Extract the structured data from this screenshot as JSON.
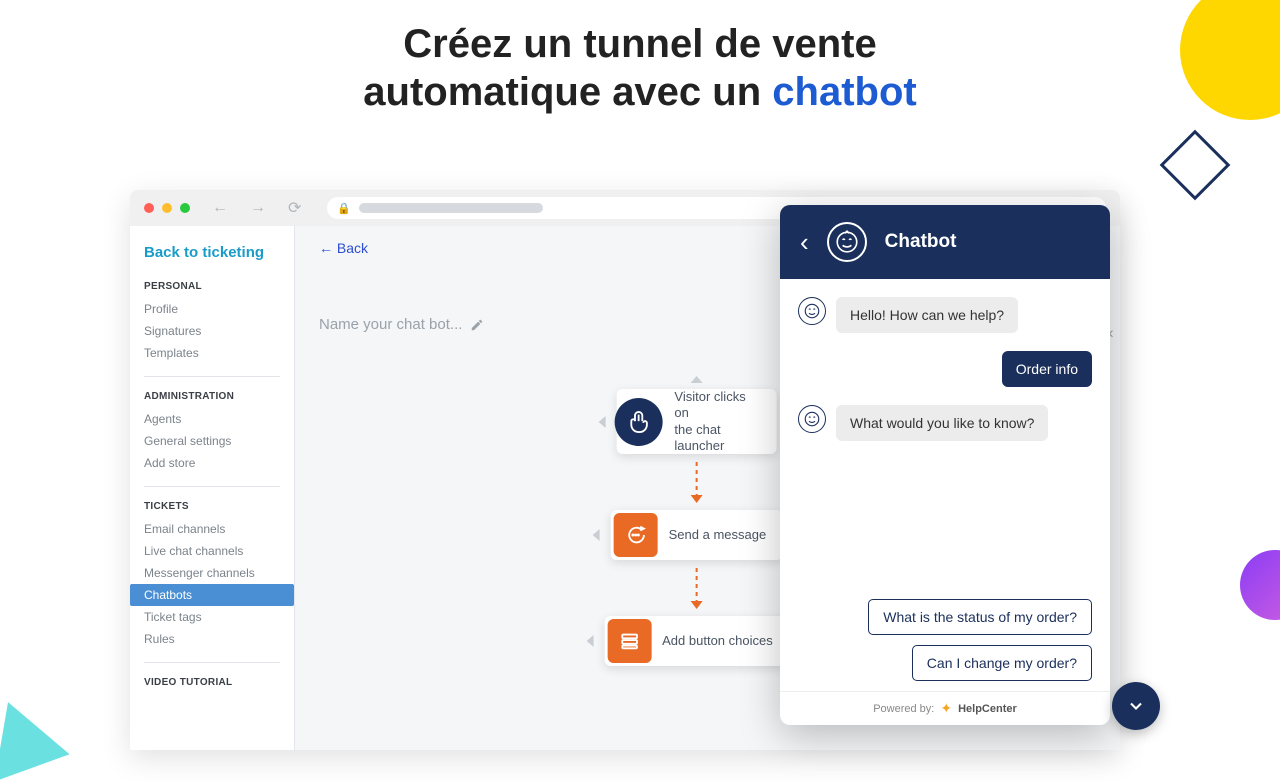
{
  "headline": {
    "line1": "Créez un tunnel de vente",
    "line2_pre": "automatique avec un ",
    "line2_accent": "chatbot"
  },
  "sidebar": {
    "back": "Back to ticketing",
    "sections": [
      {
        "head": "PERSONAL",
        "items": [
          "Profile",
          "Signatures",
          "Templates"
        ]
      },
      {
        "head": "ADMINISTRATION",
        "items": [
          "Agents",
          "General settings",
          "Add store"
        ]
      },
      {
        "head": "TICKETS",
        "items": [
          "Email channels",
          "Live chat channels",
          "Messenger channels",
          "Chatbots",
          "Ticket tags",
          "Rules"
        ]
      },
      {
        "head": "VIDEO TUTORIAL",
        "items": []
      }
    ],
    "active": "Chatbots"
  },
  "main": {
    "back": "Back",
    "name_placeholder": "Name your chat bot...",
    "nodes": [
      {
        "label": "Visitor clicks on the chat launcher",
        "kind": "navy"
      },
      {
        "label": "Send a message",
        "kind": "orange"
      },
      {
        "label": "Add button choices",
        "kind": "orange"
      }
    ]
  },
  "chat": {
    "title": "Chatbot",
    "messages": [
      {
        "role": "bot",
        "text": "Hello! How can we help?"
      },
      {
        "role": "user",
        "text": "Order info"
      },
      {
        "role": "bot",
        "text": "What would you like to know?"
      }
    ],
    "choices": [
      "What is the status of my order?",
      "Can I change my order?"
    ],
    "foot_pre": "Powered by:",
    "foot_brand": "HelpCenter"
  }
}
